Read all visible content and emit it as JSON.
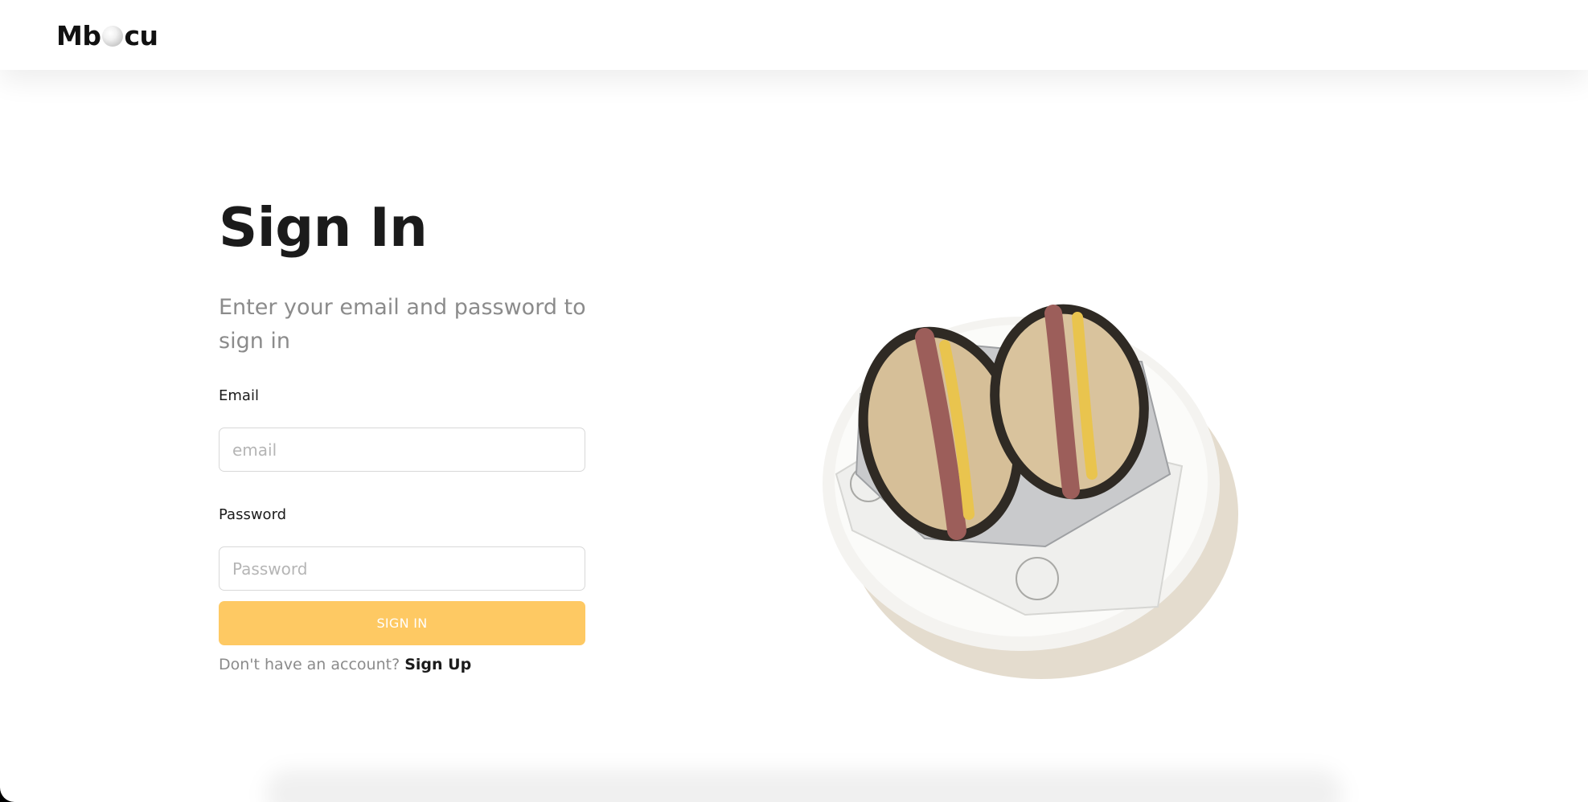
{
  "header": {
    "logo_text_before": "Mb",
    "logo_text_after": "cu"
  },
  "signin": {
    "title": "Sign In",
    "subtitle": "Enter your email and password to sign in",
    "email_label": "Email",
    "email_placeholder": "email",
    "password_label": "Password",
    "password_placeholder": "Password",
    "button_label": "SIGN IN",
    "no_account_text": "Don't have an account?",
    "signup_link": "Sign Up"
  },
  "colors": {
    "accent": "#fec963",
    "text": "#1b1b1b",
    "muted": "#8b8b8b"
  }
}
